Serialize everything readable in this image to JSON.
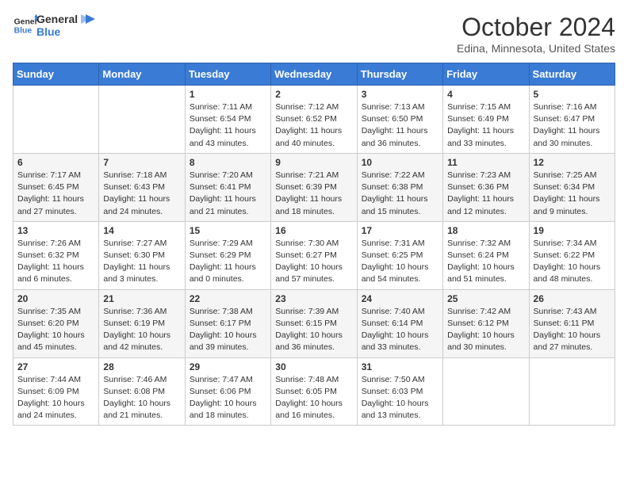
{
  "header": {
    "logo_line1": "General",
    "logo_line2": "Blue",
    "month": "October 2024",
    "location": "Edina, Minnesota, United States"
  },
  "weekdays": [
    "Sunday",
    "Monday",
    "Tuesday",
    "Wednesday",
    "Thursday",
    "Friday",
    "Saturday"
  ],
  "weeks": [
    [
      {
        "day": "",
        "sunrise": "",
        "sunset": "",
        "daylight": ""
      },
      {
        "day": "",
        "sunrise": "",
        "sunset": "",
        "daylight": ""
      },
      {
        "day": "1",
        "sunrise": "Sunrise: 7:11 AM",
        "sunset": "Sunset: 6:54 PM",
        "daylight": "Daylight: 11 hours and 43 minutes."
      },
      {
        "day": "2",
        "sunrise": "Sunrise: 7:12 AM",
        "sunset": "Sunset: 6:52 PM",
        "daylight": "Daylight: 11 hours and 40 minutes."
      },
      {
        "day": "3",
        "sunrise": "Sunrise: 7:13 AM",
        "sunset": "Sunset: 6:50 PM",
        "daylight": "Daylight: 11 hours and 36 minutes."
      },
      {
        "day": "4",
        "sunrise": "Sunrise: 7:15 AM",
        "sunset": "Sunset: 6:49 PM",
        "daylight": "Daylight: 11 hours and 33 minutes."
      },
      {
        "day": "5",
        "sunrise": "Sunrise: 7:16 AM",
        "sunset": "Sunset: 6:47 PM",
        "daylight": "Daylight: 11 hours and 30 minutes."
      }
    ],
    [
      {
        "day": "6",
        "sunrise": "Sunrise: 7:17 AM",
        "sunset": "Sunset: 6:45 PM",
        "daylight": "Daylight: 11 hours and 27 minutes."
      },
      {
        "day": "7",
        "sunrise": "Sunrise: 7:18 AM",
        "sunset": "Sunset: 6:43 PM",
        "daylight": "Daylight: 11 hours and 24 minutes."
      },
      {
        "day": "8",
        "sunrise": "Sunrise: 7:20 AM",
        "sunset": "Sunset: 6:41 PM",
        "daylight": "Daylight: 11 hours and 21 minutes."
      },
      {
        "day": "9",
        "sunrise": "Sunrise: 7:21 AM",
        "sunset": "Sunset: 6:39 PM",
        "daylight": "Daylight: 11 hours and 18 minutes."
      },
      {
        "day": "10",
        "sunrise": "Sunrise: 7:22 AM",
        "sunset": "Sunset: 6:38 PM",
        "daylight": "Daylight: 11 hours and 15 minutes."
      },
      {
        "day": "11",
        "sunrise": "Sunrise: 7:23 AM",
        "sunset": "Sunset: 6:36 PM",
        "daylight": "Daylight: 11 hours and 12 minutes."
      },
      {
        "day": "12",
        "sunrise": "Sunrise: 7:25 AM",
        "sunset": "Sunset: 6:34 PM",
        "daylight": "Daylight: 11 hours and 9 minutes."
      }
    ],
    [
      {
        "day": "13",
        "sunrise": "Sunrise: 7:26 AM",
        "sunset": "Sunset: 6:32 PM",
        "daylight": "Daylight: 11 hours and 6 minutes."
      },
      {
        "day": "14",
        "sunrise": "Sunrise: 7:27 AM",
        "sunset": "Sunset: 6:30 PM",
        "daylight": "Daylight: 11 hours and 3 minutes."
      },
      {
        "day": "15",
        "sunrise": "Sunrise: 7:29 AM",
        "sunset": "Sunset: 6:29 PM",
        "daylight": "Daylight: 11 hours and 0 minutes."
      },
      {
        "day": "16",
        "sunrise": "Sunrise: 7:30 AM",
        "sunset": "Sunset: 6:27 PM",
        "daylight": "Daylight: 10 hours and 57 minutes."
      },
      {
        "day": "17",
        "sunrise": "Sunrise: 7:31 AM",
        "sunset": "Sunset: 6:25 PM",
        "daylight": "Daylight: 10 hours and 54 minutes."
      },
      {
        "day": "18",
        "sunrise": "Sunrise: 7:32 AM",
        "sunset": "Sunset: 6:24 PM",
        "daylight": "Daylight: 10 hours and 51 minutes."
      },
      {
        "day": "19",
        "sunrise": "Sunrise: 7:34 AM",
        "sunset": "Sunset: 6:22 PM",
        "daylight": "Daylight: 10 hours and 48 minutes."
      }
    ],
    [
      {
        "day": "20",
        "sunrise": "Sunrise: 7:35 AM",
        "sunset": "Sunset: 6:20 PM",
        "daylight": "Daylight: 10 hours and 45 minutes."
      },
      {
        "day": "21",
        "sunrise": "Sunrise: 7:36 AM",
        "sunset": "Sunset: 6:19 PM",
        "daylight": "Daylight: 10 hours and 42 minutes."
      },
      {
        "day": "22",
        "sunrise": "Sunrise: 7:38 AM",
        "sunset": "Sunset: 6:17 PM",
        "daylight": "Daylight: 10 hours and 39 minutes."
      },
      {
        "day": "23",
        "sunrise": "Sunrise: 7:39 AM",
        "sunset": "Sunset: 6:15 PM",
        "daylight": "Daylight: 10 hours and 36 minutes."
      },
      {
        "day": "24",
        "sunrise": "Sunrise: 7:40 AM",
        "sunset": "Sunset: 6:14 PM",
        "daylight": "Daylight: 10 hours and 33 minutes."
      },
      {
        "day": "25",
        "sunrise": "Sunrise: 7:42 AM",
        "sunset": "Sunset: 6:12 PM",
        "daylight": "Daylight: 10 hours and 30 minutes."
      },
      {
        "day": "26",
        "sunrise": "Sunrise: 7:43 AM",
        "sunset": "Sunset: 6:11 PM",
        "daylight": "Daylight: 10 hours and 27 minutes."
      }
    ],
    [
      {
        "day": "27",
        "sunrise": "Sunrise: 7:44 AM",
        "sunset": "Sunset: 6:09 PM",
        "daylight": "Daylight: 10 hours and 24 minutes."
      },
      {
        "day": "28",
        "sunrise": "Sunrise: 7:46 AM",
        "sunset": "Sunset: 6:08 PM",
        "daylight": "Daylight: 10 hours and 21 minutes."
      },
      {
        "day": "29",
        "sunrise": "Sunrise: 7:47 AM",
        "sunset": "Sunset: 6:06 PM",
        "daylight": "Daylight: 10 hours and 18 minutes."
      },
      {
        "day": "30",
        "sunrise": "Sunrise: 7:48 AM",
        "sunset": "Sunset: 6:05 PM",
        "daylight": "Daylight: 10 hours and 16 minutes."
      },
      {
        "day": "31",
        "sunrise": "Sunrise: 7:50 AM",
        "sunset": "Sunset: 6:03 PM",
        "daylight": "Daylight: 10 hours and 13 minutes."
      },
      {
        "day": "",
        "sunrise": "",
        "sunset": "",
        "daylight": ""
      },
      {
        "day": "",
        "sunrise": "",
        "sunset": "",
        "daylight": ""
      }
    ]
  ]
}
